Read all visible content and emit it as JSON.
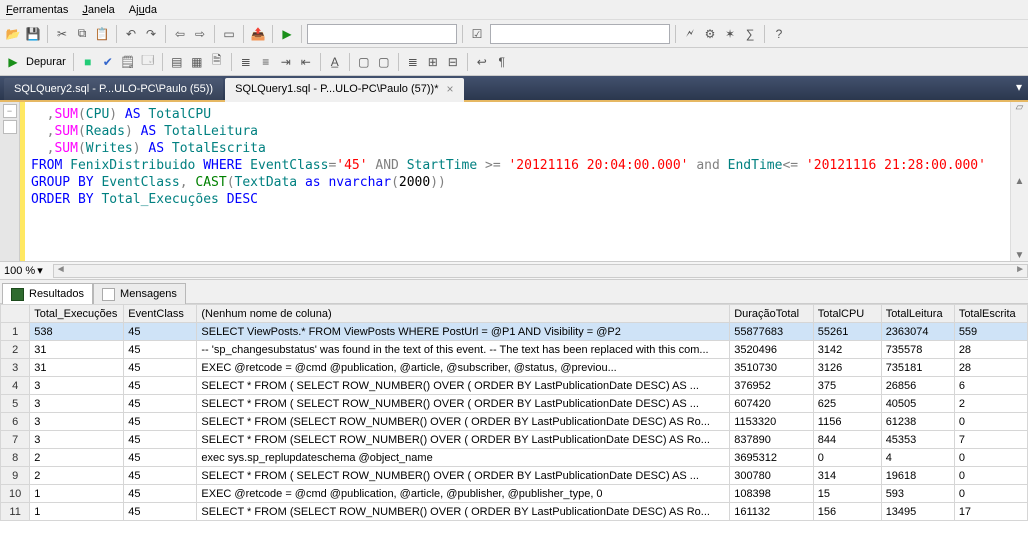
{
  "menu": {
    "ferramentas": "Ferramentas",
    "janela": "Janela",
    "ajuda": "Ajuda"
  },
  "debug_btn": "Depurar",
  "databases_placeholder": "",
  "tabs": {
    "t0": "SQLQuery2.sql - P...ULO-PC\\Paulo (55))",
    "t1": "SQLQuery1.sql - P...ULO-PC\\Paulo (57))*"
  },
  "zoom": "100 %",
  "result_tabs": {
    "resultados": "Resultados",
    "mensagens": "Mensagens"
  },
  "grid": {
    "h_exec": "Total_Execuções",
    "h_ev": "EventClass",
    "h_q": "(Nenhum nome de coluna)",
    "h_d": "DuraçãoTotal",
    "h_c": "TotalCPU",
    "h_l": "TotalLeitura",
    "h_e": "TotalEscrita",
    "rows": [
      {
        "n": "1",
        "exec": "538",
        "ev": "45",
        "q": "SELECT ViewPosts.* FROM ViewPosts WHERE PostUrl = @P1 AND Visibility = @P2",
        "d": "55877683",
        "c": "55261",
        "l": "2363074",
        "e": "559"
      },
      {
        "n": "2",
        "exec": "31",
        "ev": "45",
        "q": "-- 'sp_changesubstatus' was found in the text of this event. -- The text has been replaced with this com...",
        "d": "3520496",
        "c": "3142",
        "l": "735578",
        "e": "28"
      },
      {
        "n": "3",
        "exec": "31",
        "ev": "45",
        "q": "EXEC @retcode = @cmd      @publication,      @article,      @subscriber,      @status,      @previou...",
        "d": "3510730",
        "c": "3126",
        "l": "735181",
        "e": "28"
      },
      {
        "n": "4",
        "exec": "3",
        "ev": "45",
        "q": "SELECT * FROM (     SELECT ROW_NUMBER() OVER ( ORDER BY LastPublicationDate DESC) AS ...",
        "d": "376952",
        "c": "375",
        "l": "26856",
        "e": "6"
      },
      {
        "n": "5",
        "exec": "3",
        "ev": "45",
        "q": "SELECT * FROM (     SELECT ROW_NUMBER() OVER ( ORDER BY LastPublicationDate DESC) AS ...",
        "d": "607420",
        "c": "625",
        "l": "40505",
        "e": "2"
      },
      {
        "n": "6",
        "exec": "3",
        "ev": "45",
        "q": "SELECT * FROM (SELECT ROW_NUMBER() OVER ( ORDER BY LastPublicationDate DESC) AS Ro...",
        "d": "1153320",
        "c": "1156",
        "l": "61238",
        "e": "0"
      },
      {
        "n": "7",
        "exec": "3",
        "ev": "45",
        "q": "SELECT * FROM (SELECT ROW_NUMBER() OVER ( ORDER BY LastPublicationDate DESC) AS Ro...",
        "d": "837890",
        "c": "844",
        "l": "45353",
        "e": "7"
      },
      {
        "n": "8",
        "exec": "2",
        "ev": "45",
        "q": "exec sys.sp_replupdateschema @object_name",
        "d": "3695312",
        "c": "0",
        "l": "4",
        "e": "0"
      },
      {
        "n": "9",
        "exec": "2",
        "ev": "45",
        "q": "SELECT * FROM (     SELECT ROW_NUMBER() OVER ( ORDER BY LastPublicationDate DESC) AS ...",
        "d": "300780",
        "c": "314",
        "l": "19618",
        "e": "0"
      },
      {
        "n": "10",
        "exec": "1",
        "ev": "45",
        "q": "EXEC @retcode = @cmd      @publication,      @article,      @publisher,      @publisher_type,      0",
        "d": "108398",
        "c": "15",
        "l": "593",
        "e": "0"
      },
      {
        "n": "11",
        "exec": "1",
        "ev": "45",
        "q": "SELECT * FROM (SELECT ROW_NUMBER() OVER ( ORDER BY LastPublicationDate DESC) AS Ro...",
        "d": "161132",
        "c": "156",
        "l": "13495",
        "e": "17"
      }
    ]
  },
  "sql": {
    "l1_a": "  ,",
    "l1_b": "SUM",
    "l1_c": "(",
    "l1_d": "CPU",
    "l1_e": ")",
    "l1_f": " AS ",
    "l1_g": "TotalCPU",
    "l2_a": "  ,",
    "l2_b": "SUM",
    "l2_c": "(",
    "l2_d": "Reads",
    "l2_e": ")",
    "l2_f": " AS ",
    "l2_g": "TotalLeitura",
    "l3_a": "  ,",
    "l3_b": "SUM",
    "l3_c": "(",
    "l3_d": "Writes",
    "l3_e": ")",
    "l3_f": " AS ",
    "l3_g": "TotalEscrita",
    "l4_a": "FROM",
    "l4_b": " FenixDistribuido ",
    "l4_c": "WHERE",
    "l4_d": " EventClass",
    "l4_e": "=",
    "l4_f": "'45'",
    "l4_g": " AND ",
    "l4_h": "StartTime ",
    "l4_i": ">=",
    "l4_j": " '20121116 20:04:00.000'",
    "l4_k": " and ",
    "l4_l": "EndTime",
    "l4_m": "<=",
    "l4_n": " '20121116 21:28:00.000'",
    "l5_a": "GROUP",
    "l5_b": " BY",
    "l5_c": " EventClass",
    "l5_d": ",",
    "l5_e": " CAST",
    "l5_f": "(",
    "l5_g": "TextData ",
    "l5_h": "as",
    "l5_i": " nvarchar",
    "l5_j": "(",
    "l5_k": "2000",
    "l5_l": "))",
    "l6_a": "ORDER",
    "l6_b": " BY",
    "l6_c": " Total_Execuções ",
    "l6_d": "DESC"
  }
}
